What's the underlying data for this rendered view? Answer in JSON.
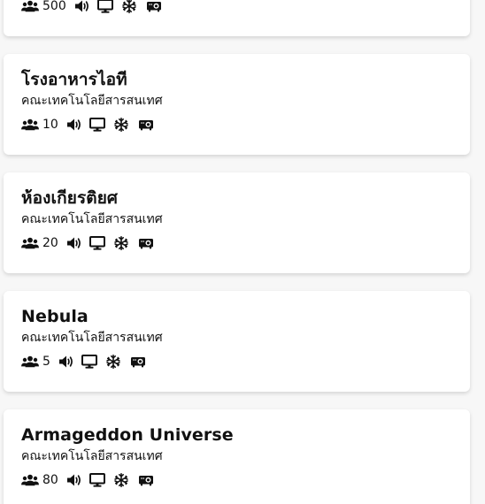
{
  "rooms": [
    {
      "name": "",
      "faculty": "",
      "capacity": "500"
    },
    {
      "name": "โรงอาหารไอที",
      "faculty": "คณะเทคโนโลยีสารสนเทศ",
      "capacity": "10"
    },
    {
      "name": "ห้องเกียรติยศ",
      "faculty": "คณะเทคโนโลยีสารสนเทศ",
      "capacity": "20"
    },
    {
      "name": "Nebula",
      "faculty": "คณะเทคโนโลยีสารสนเทศ",
      "capacity": "5"
    },
    {
      "name": "Armageddon Universe",
      "faculty": "คณะเทคโนโลยีสารสนเทศ",
      "capacity": "80"
    }
  ],
  "facility_icons": [
    "people-icon",
    "speaker-icon",
    "monitor-icon",
    "snowflake-icon",
    "projector-icon"
  ],
  "colors": {
    "text": "#111111",
    "card": "#ffffff",
    "background": "#f7f7f7"
  }
}
